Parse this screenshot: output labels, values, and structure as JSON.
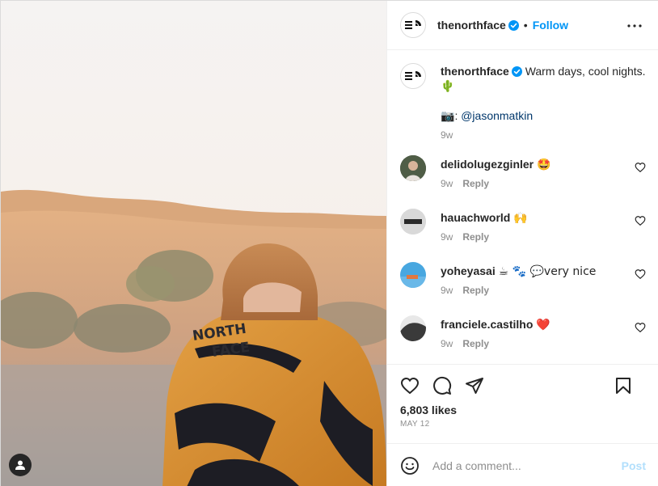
{
  "post": {
    "author": "thenorthface",
    "follow_label": "Follow",
    "separator": "•",
    "caption": {
      "author": "thenorthface",
      "text": "Warm days, cool nights.",
      "emoji": "🌵",
      "credit_emoji": "📷",
      "credit_sep": ":",
      "credit_handle": "@jasonmatkin",
      "time": "9w"
    },
    "comments": [
      {
        "user": "delidolugezginler",
        "text": "🤩",
        "time": "9w",
        "reply": "Reply"
      },
      {
        "user": "hauachworld",
        "text": "🙌",
        "time": "9w",
        "reply": "Reply"
      },
      {
        "user": "yoheyasai",
        "text": "☕ 🐾 💬very nice",
        "time": "9w",
        "reply": "Reply"
      },
      {
        "user": "franciele.castilho",
        "text": "❤️",
        "time": "9w",
        "reply": "Reply"
      }
    ],
    "likes": "6,803 likes",
    "date": "MAY 12"
  },
  "add_comment": {
    "placeholder": "Add a comment...",
    "post_label": "Post"
  },
  "colors": {
    "accent": "#0095f6",
    "text": "#262626",
    "muted": "#8e8e8e",
    "post_disabled": "#b2dffc"
  },
  "icons": [
    "verified-icon",
    "more-options-icon",
    "heart-icon",
    "comment-icon",
    "share-icon",
    "bookmark-icon",
    "emoji-icon",
    "user-tag-icon"
  ]
}
